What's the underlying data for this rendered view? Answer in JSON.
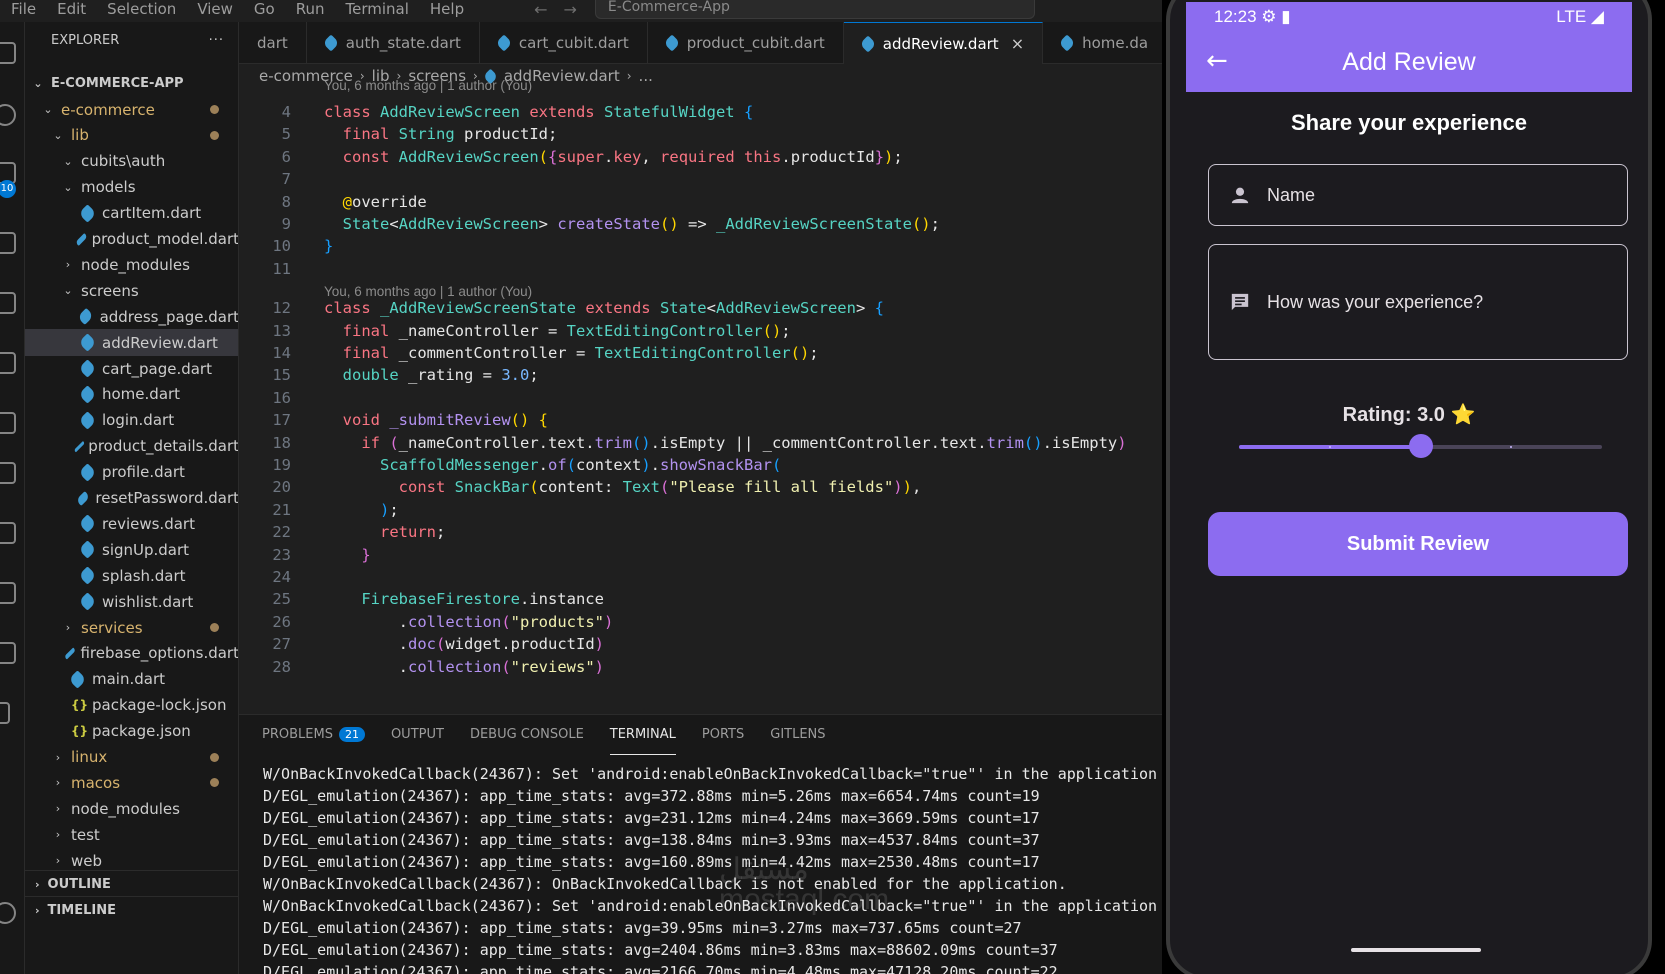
{
  "menubar": {
    "items": [
      "File",
      "Edit",
      "Selection",
      "View",
      "Go",
      "Run",
      "Terminal",
      "Help"
    ],
    "search": "E-Commerce-App"
  },
  "activity": {
    "badge": "10"
  },
  "explorer": {
    "title": "EXPLORER",
    "more": "···",
    "project": "E-COMMERCE-APP",
    "rows": [
      {
        "label": "e-commerce",
        "kind": "folder-mod",
        "open": true,
        "dot": true
      },
      {
        "label": "lib",
        "kind": "folder-mod",
        "open": true,
        "dot": true
      },
      {
        "label": "cubits\\auth",
        "kind": "folder",
        "open": true
      },
      {
        "label": "models",
        "kind": "folder",
        "open": true
      },
      {
        "label": "cartItem.dart",
        "kind": "dart"
      },
      {
        "label": "product_model.dart",
        "kind": "dart"
      },
      {
        "label": "node_modules",
        "kind": "folder",
        "open": false
      },
      {
        "label": "screens",
        "kind": "folder",
        "open": true
      },
      {
        "label": "address_page.dart",
        "kind": "dart"
      },
      {
        "label": "addReview.dart",
        "kind": "dart",
        "selected": true
      },
      {
        "label": "cart_page.dart",
        "kind": "dart"
      },
      {
        "label": "home.dart",
        "kind": "dart"
      },
      {
        "label": "login.dart",
        "kind": "dart"
      },
      {
        "label": "product_details.dart",
        "kind": "dart"
      },
      {
        "label": "profile.dart",
        "kind": "dart"
      },
      {
        "label": "resetPassword.dart",
        "kind": "dart"
      },
      {
        "label": "reviews.dart",
        "kind": "dart"
      },
      {
        "label": "signUp.dart",
        "kind": "dart"
      },
      {
        "label": "splash.dart",
        "kind": "dart"
      },
      {
        "label": "wishlist.dart",
        "kind": "dart"
      },
      {
        "label": "services",
        "kind": "folder-mod",
        "open": false,
        "dot": true
      },
      {
        "label": "firebase_options.dart",
        "kind": "dart"
      },
      {
        "label": "main.dart",
        "kind": "dart"
      },
      {
        "label": "package-lock.json",
        "kind": "json"
      },
      {
        "label": "package.json",
        "kind": "json"
      },
      {
        "label": "linux",
        "kind": "folder-mod",
        "open": false,
        "dot": true
      },
      {
        "label": "macos",
        "kind": "folder-mod",
        "open": false,
        "dot": true
      },
      {
        "label": "node_modules",
        "kind": "folder",
        "open": false
      },
      {
        "label": "test",
        "kind": "folder",
        "open": false
      },
      {
        "label": "web",
        "kind": "folder",
        "open": false
      }
    ],
    "outline": "OUTLINE",
    "timeline": "TIMELINE"
  },
  "editor": {
    "tabs": [
      {
        "label": "dart",
        "icon": false,
        "active": false
      },
      {
        "label": "auth_state.dart",
        "icon": true,
        "active": false
      },
      {
        "label": "cart_cubit.dart",
        "icon": true,
        "active": false
      },
      {
        "label": "product_cubit.dart",
        "icon": true,
        "active": false
      },
      {
        "label": "addReview.dart",
        "icon": true,
        "active": true
      },
      {
        "label": "home.da",
        "icon": true,
        "active": false
      }
    ],
    "breadcrumb": [
      "e-commerce",
      "lib",
      "screens",
      "addReview.dart",
      "..."
    ],
    "codelens_top": "You, 6 months ago | 1 author (You)",
    "codelens_mid": "You, 6 months ago | 1 author (You)",
    "lines": [
      {
        "n": "4",
        "t": [
          [
            "kw",
            "class "
          ],
          [
            "ty",
            "AddReviewScreen "
          ],
          [
            "kw",
            "extends "
          ],
          [
            "ty",
            "StatefulWidget "
          ],
          [
            "br3",
            "{"
          ]
        ]
      },
      {
        "n": "5",
        "t": [
          [
            "txt",
            "  "
          ],
          [
            "kw",
            "final "
          ],
          [
            "ty",
            "String "
          ],
          [
            "txt",
            "productId;"
          ]
        ]
      },
      {
        "n": "6",
        "t": [
          [
            "txt",
            "  "
          ],
          [
            "kw",
            "const "
          ],
          [
            "ty",
            "AddReviewScreen"
          ],
          [
            "br1",
            "("
          ],
          [
            "br2",
            "{"
          ],
          [
            "kw",
            "super"
          ],
          [
            "txt",
            "."
          ],
          [
            "kw",
            "key"
          ],
          [
            "txt",
            ", "
          ],
          [
            "kw",
            "required this"
          ],
          [
            "txt",
            ".productId"
          ],
          [
            "br2",
            "}"
          ],
          [
            "br1",
            ")"
          ],
          [
            "txt",
            ";"
          ]
        ]
      },
      {
        "n": "7",
        "t": []
      },
      {
        "n": "8",
        "t": [
          [
            "txt",
            "  "
          ],
          [
            "br1",
            "@"
          ],
          [
            "txt",
            "override"
          ]
        ]
      },
      {
        "n": "9",
        "t": [
          [
            "txt",
            "  "
          ],
          [
            "ty",
            "State"
          ],
          [
            "txt",
            "<"
          ],
          [
            "ty",
            "AddReviewScreen"
          ],
          [
            "txt",
            "> "
          ],
          [
            "fn",
            "createState"
          ],
          [
            "br1",
            "()"
          ],
          [
            "txt",
            " => "
          ],
          [
            "ty",
            "_AddReviewScreenState"
          ],
          [
            "br1",
            "()"
          ],
          [
            "txt",
            ";"
          ]
        ]
      },
      {
        "n": "10",
        "t": [
          [
            "br3",
            "}"
          ]
        ]
      },
      {
        "n": "11",
        "t": []
      },
      {
        "n": "12",
        "t": [
          [
            "kw",
            "class "
          ],
          [
            "ty",
            "_AddReviewScreenState "
          ],
          [
            "kw",
            "extends "
          ],
          [
            "ty",
            "State"
          ],
          [
            "txt",
            "<"
          ],
          [
            "ty",
            "AddReviewScreen"
          ],
          [
            "txt",
            "> "
          ],
          [
            "br3",
            "{"
          ]
        ]
      },
      {
        "n": "13",
        "t": [
          [
            "txt",
            "  "
          ],
          [
            "kw",
            "final "
          ],
          [
            "txt",
            "_nameController = "
          ],
          [
            "ty",
            "TextEditingController"
          ],
          [
            "br1",
            "()"
          ],
          [
            "txt",
            ";"
          ]
        ]
      },
      {
        "n": "14",
        "t": [
          [
            "txt",
            "  "
          ],
          [
            "kw",
            "final "
          ],
          [
            "txt",
            "_commentController = "
          ],
          [
            "ty",
            "TextEditingController"
          ],
          [
            "br1",
            "()"
          ],
          [
            "txt",
            ";"
          ]
        ]
      },
      {
        "n": "15",
        "t": [
          [
            "txt",
            "  "
          ],
          [
            "ty",
            "double "
          ],
          [
            "txt",
            "_rating = "
          ],
          [
            "num",
            "3.0"
          ],
          [
            "txt",
            ";"
          ]
        ]
      },
      {
        "n": "16",
        "t": []
      },
      {
        "n": "17",
        "t": [
          [
            "txt",
            "  "
          ],
          [
            "kw",
            "void "
          ],
          [
            "fn",
            "_submitReview"
          ],
          [
            "br1",
            "() {"
          ]
        ]
      },
      {
        "n": "18",
        "t": [
          [
            "txt",
            "    "
          ],
          [
            "kw",
            "if "
          ],
          [
            "br2",
            "("
          ],
          [
            "txt",
            "_nameController.text."
          ],
          [
            "fn",
            "trim"
          ],
          [
            "br3",
            "()"
          ],
          [
            "txt",
            ".isEmpty || _commentController.text."
          ],
          [
            "fn",
            "trim"
          ],
          [
            "br3",
            "()"
          ],
          [
            "txt",
            ".isEmpty"
          ],
          [
            "br2",
            ")"
          ]
        ]
      },
      {
        "n": "19",
        "t": [
          [
            "txt",
            "      "
          ],
          [
            "ty",
            "ScaffoldMessenger"
          ],
          [
            "txt",
            "."
          ],
          [
            "fn",
            "of"
          ],
          [
            "br3",
            "("
          ],
          [
            "txt",
            "context"
          ],
          [
            "br3",
            ")"
          ],
          [
            "txt",
            "."
          ],
          [
            "fn",
            "showSnackBar"
          ],
          [
            "br3",
            "("
          ]
        ]
      },
      {
        "n": "20",
        "t": [
          [
            "txt",
            "        "
          ],
          [
            "kw",
            "const "
          ],
          [
            "ty",
            "SnackBar"
          ],
          [
            "br1",
            "("
          ],
          [
            "txt",
            "content: "
          ],
          [
            "ty",
            "Text"
          ],
          [
            "br2",
            "("
          ],
          [
            "str",
            "\"Please fill all fields\""
          ],
          [
            "br2",
            ")"
          ],
          [
            "br1",
            ")"
          ],
          [
            "txt",
            ","
          ]
        ]
      },
      {
        "n": "21",
        "t": [
          [
            "txt",
            "      "
          ],
          [
            "br3",
            ")"
          ],
          [
            "txt",
            ";"
          ]
        ]
      },
      {
        "n": "22",
        "t": [
          [
            "txt",
            "      "
          ],
          [
            "kw",
            "return"
          ],
          [
            "txt",
            ";"
          ]
        ]
      },
      {
        "n": "23",
        "t": [
          [
            "txt",
            "    "
          ],
          [
            "br2",
            "}"
          ]
        ]
      },
      {
        "n": "24",
        "t": []
      },
      {
        "n": "25",
        "t": [
          [
            "txt",
            "    "
          ],
          [
            "ty",
            "FirebaseFirestore"
          ],
          [
            "txt",
            ".instance"
          ]
        ]
      },
      {
        "n": "26",
        "t": [
          [
            "txt",
            "        ."
          ],
          [
            "fn",
            "collection"
          ],
          [
            "br2",
            "("
          ],
          [
            "str",
            "\"products\""
          ],
          [
            "br2",
            ")"
          ]
        ]
      },
      {
        "n": "27",
        "t": [
          [
            "txt",
            "        ."
          ],
          [
            "fn",
            "doc"
          ],
          [
            "br2",
            "("
          ],
          [
            "txt",
            "widget.productId"
          ],
          [
            "br2",
            ")"
          ]
        ]
      },
      {
        "n": "28",
        "t": [
          [
            "txt",
            "        ."
          ],
          [
            "fn",
            "collection"
          ],
          [
            "br2",
            "("
          ],
          [
            "str",
            "\"reviews\""
          ],
          [
            "br2",
            ")"
          ]
        ]
      }
    ]
  },
  "panel": {
    "tabs": [
      {
        "label": "PROBLEMS",
        "count": "21",
        "active": false
      },
      {
        "label": "OUTPUT",
        "active": false
      },
      {
        "label": "DEBUG CONSOLE",
        "active": false
      },
      {
        "label": "TERMINAL",
        "active": true
      },
      {
        "label": "PORTS",
        "active": false
      },
      {
        "label": "GITLENS",
        "active": false
      }
    ],
    "lines": [
      "W/OnBackInvokedCallback(24367): Set 'android:enableOnBackInvokedCallback=\"true\"' in the application",
      "D/EGL_emulation(24367): app_time_stats: avg=372.88ms min=5.26ms max=6654.74ms count=19",
      "D/EGL_emulation(24367): app_time_stats: avg=231.12ms min=4.24ms max=3669.59ms count=17",
      "D/EGL_emulation(24367): app_time_stats: avg=138.84ms min=3.93ms max=4537.84ms count=37",
      "D/EGL_emulation(24367): app_time_stats: avg=160.89ms min=4.42ms max=2530.48ms count=17",
      "W/OnBackInvokedCallback(24367): OnBackInvokedCallback is not enabled for the application.",
      "W/OnBackInvokedCallback(24367): Set 'android:enableOnBackInvokedCallback=\"true\"' in the application",
      "D/EGL_emulation(24367): app_time_stats: avg=39.95ms min=3.27ms max=737.65ms count=27",
      "D/EGL_emulation(24367): app_time_stats: avg=2404.86ms min=3.83ms max=88602.09ms count=37",
      "D/EGL_emulation(24367): app_time_stats: avg=2166.70ms min=4.48ms max=47128.20ms count=22"
    ],
    "watermark_line1": "مستقل",
    "watermark_line2": "mostaql.com"
  },
  "phone": {
    "time": "12:23",
    "network": "LTE",
    "appbar_title": "Add Review",
    "heading": "Share your experience",
    "name_placeholder": "Name",
    "comment_placeholder": "How was your experience?",
    "rating_label": "Rating: 3.0",
    "rating_star": "⭐",
    "rating_value": 3.0,
    "rating_min": 1,
    "rating_max": 5,
    "submit_label": "Submit Review",
    "accent": "#8c6cf0"
  }
}
